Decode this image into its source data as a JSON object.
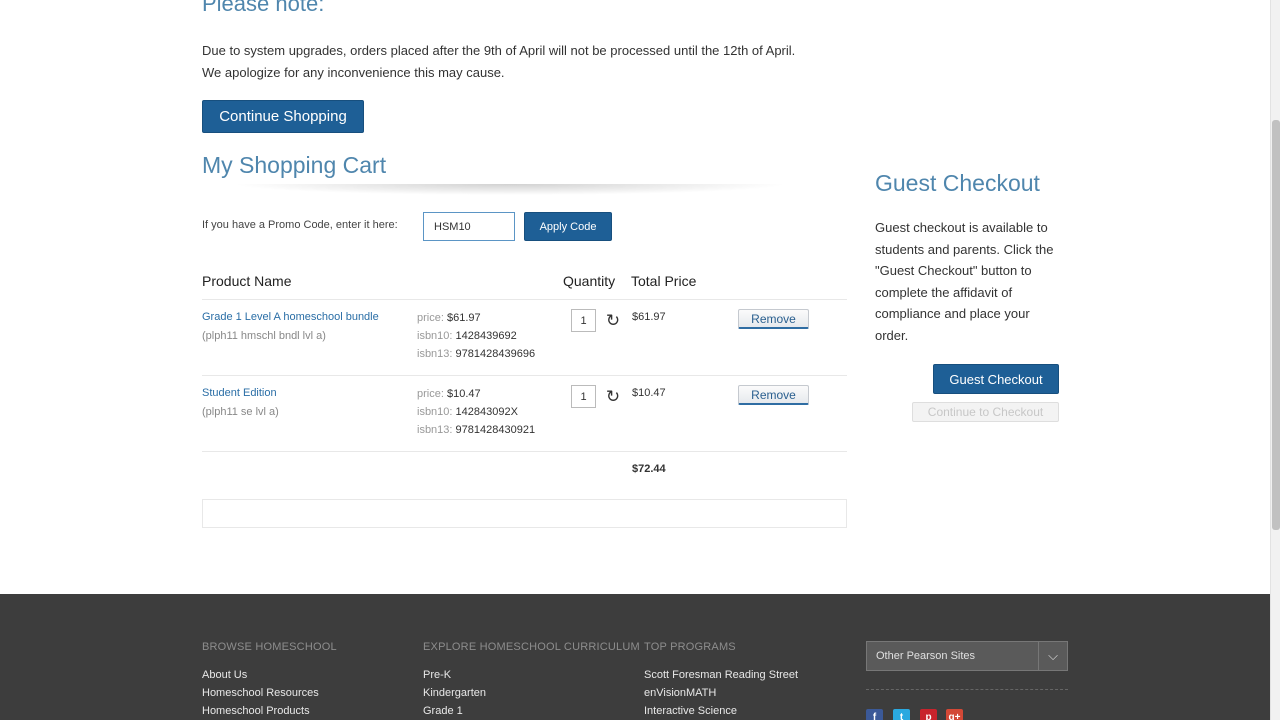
{
  "notice": {
    "heading": "Please note:",
    "line1": "Due to system upgrades, orders placed after the 9th of April will not be processed until the 12th of April.",
    "line2": "We apologize for any inconvenience this may cause."
  },
  "continue_label": "Continue Shopping",
  "cart": {
    "title": "My Shopping Cart",
    "promo_label": "If you have a Promo Code, enter it here:",
    "promo_value": "HSM10",
    "apply_label": "Apply Code",
    "headers": {
      "product": "Product Name",
      "quantity": "Quantity",
      "total": "Total Price"
    },
    "items": [
      {
        "name": "Grade 1 Level A homeschool bundle",
        "code": "(plph11 hmschl bndl lvl a)",
        "price_label": "price:",
        "price": "$61.97",
        "isbn10_label": "isbn10:",
        "isbn10": "1428439692",
        "isbn13_label": "isbn13:",
        "isbn13": "9781428439696",
        "qty": "1",
        "total": "$61.97",
        "remove_label": "Remove"
      },
      {
        "name": "Student Edition",
        "code": "(plph11 se lvl a)",
        "price_label": "price:",
        "price": "$10.47",
        "isbn10_label": "isbn10:",
        "isbn10": "142843092X",
        "isbn13_label": "isbn13:",
        "isbn13": "9781428430921",
        "qty": "1",
        "total": "$10.47",
        "remove_label": "Remove"
      }
    ],
    "grand_total": "$72.44"
  },
  "guest": {
    "title": "Guest Checkout",
    "text": "Guest checkout is available to students and parents. Click the \"Guest Checkout\" button to complete the affidavit of compliance and place your order.",
    "guest_btn": "Guest Checkout",
    "checkout_btn": "Continue to Checkout"
  },
  "footer": {
    "col1": {
      "heading": "Browse Homeschool",
      "links": [
        "About Us",
        "Homeschool Resources",
        "Homeschool Products"
      ]
    },
    "col2": {
      "heading": "Explore Homeschool Curriculum",
      "links": [
        "Pre-K",
        "Kindergarten",
        "Grade 1"
      ]
    },
    "col3": {
      "heading": "Top Programs",
      "links": [
        "Scott Foresman Reading Street",
        "enVisionMATH",
        "Interactive Science"
      ]
    },
    "select_value": "Other Pearson Sites",
    "social": [
      {
        "icon": "facebook-icon",
        "glyph": "f",
        "color": "#3b5998"
      },
      {
        "icon": "twitter-icon",
        "glyph": "t",
        "color": "#2aa9e0"
      },
      {
        "icon": "pinterest-icon",
        "glyph": "p",
        "color": "#c8232c"
      },
      {
        "icon": "google-plus-icon",
        "glyph": "g+",
        "color": "#d34836"
      }
    ]
  },
  "colors": {
    "primary": "#1e5f96",
    "heading": "#4f86ad",
    "link": "#2a6ea6",
    "footer_bg": "#3d3d3d"
  }
}
